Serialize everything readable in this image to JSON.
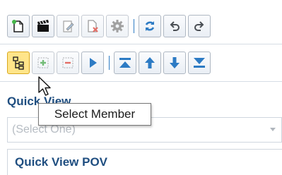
{
  "toolbar_row1": {
    "buttons": [
      {
        "icon": "new-document-icon"
      },
      {
        "icon": "clapperboard-icon"
      },
      {
        "icon": "edit-document-icon"
      },
      {
        "icon": "delete-document-icon"
      },
      {
        "icon": "gear-icon"
      },
      {
        "icon": "refresh-icon"
      },
      {
        "icon": "undo-icon"
      },
      {
        "icon": "redo-icon"
      }
    ]
  },
  "toolbar_row2": {
    "buttons": [
      {
        "icon": "member-tree-icon",
        "state": "active"
      },
      {
        "icon": "add-member-icon"
      },
      {
        "icon": "remove-member-icon"
      },
      {
        "icon": "play-icon"
      },
      {
        "icon": "move-top-icon"
      },
      {
        "icon": "move-up-icon"
      },
      {
        "icon": "move-down-icon"
      },
      {
        "icon": "move-bottom-icon"
      }
    ]
  },
  "quick_view": {
    "label": "Quick View",
    "select_placeholder": "(Select One)"
  },
  "quick_view_pov": {
    "title": "Quick View POV"
  },
  "tooltip": {
    "text": "Select Member"
  },
  "colors": {
    "accent_blue": "#2d7bc4",
    "heading_blue": "#1f4e80",
    "active_yellow": "#ffe58a"
  }
}
